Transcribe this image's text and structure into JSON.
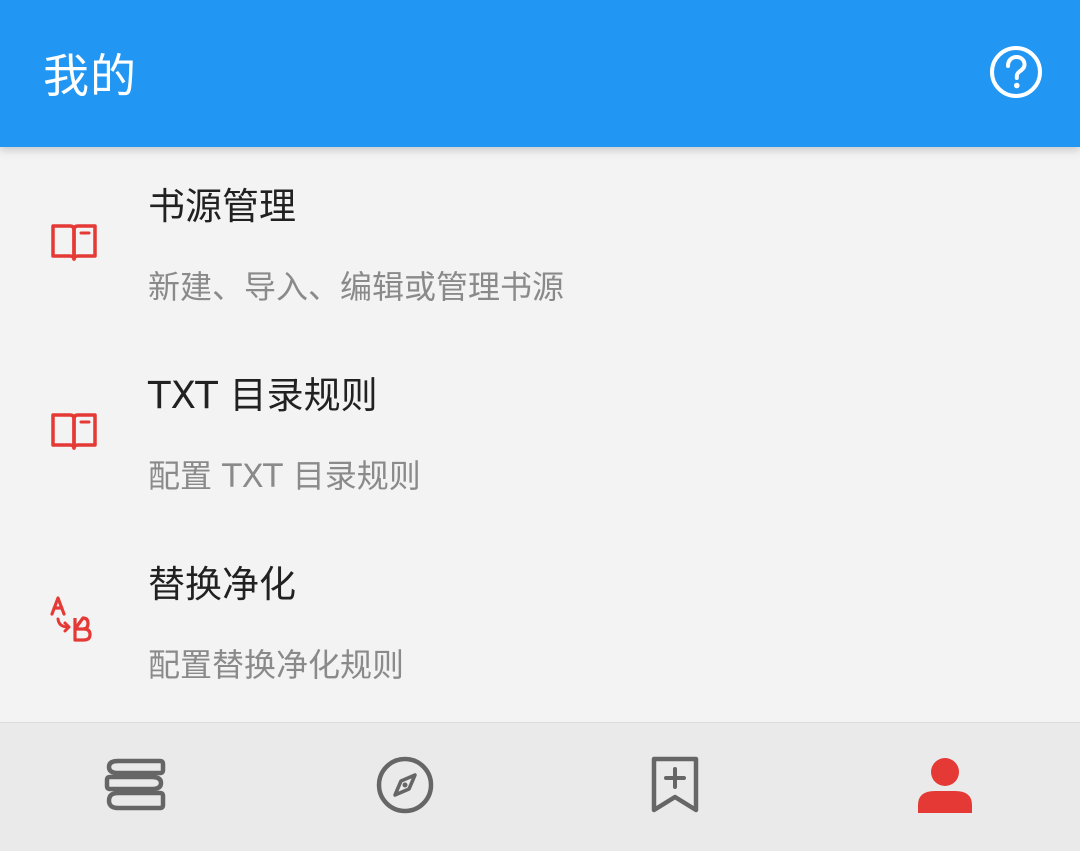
{
  "app_bar": {
    "title": "我的",
    "help_icon": "help-circle-icon",
    "background": "#2196f3"
  },
  "menu": {
    "items": [
      {
        "title": "书源管理",
        "subtitle": "新建、导入、编辑或管理书源",
        "icon": "book-icon"
      },
      {
        "title": "TXT 目录规则",
        "subtitle": "配置 TXT 目录规则",
        "icon": "book-icon"
      },
      {
        "title": "替换净化",
        "subtitle": "配置替换净化规则",
        "icon": "replace-ab-icon"
      }
    ],
    "icon_color": "#e53935"
  },
  "bottom_nav": {
    "items": [
      {
        "icon": "bookshelf-icon",
        "active": false
      },
      {
        "icon": "compass-icon",
        "active": false
      },
      {
        "icon": "bookmark-add-icon",
        "active": false
      },
      {
        "icon": "person-icon",
        "active": true
      }
    ],
    "active_color": "#e53935",
    "inactive_color": "#666666"
  }
}
